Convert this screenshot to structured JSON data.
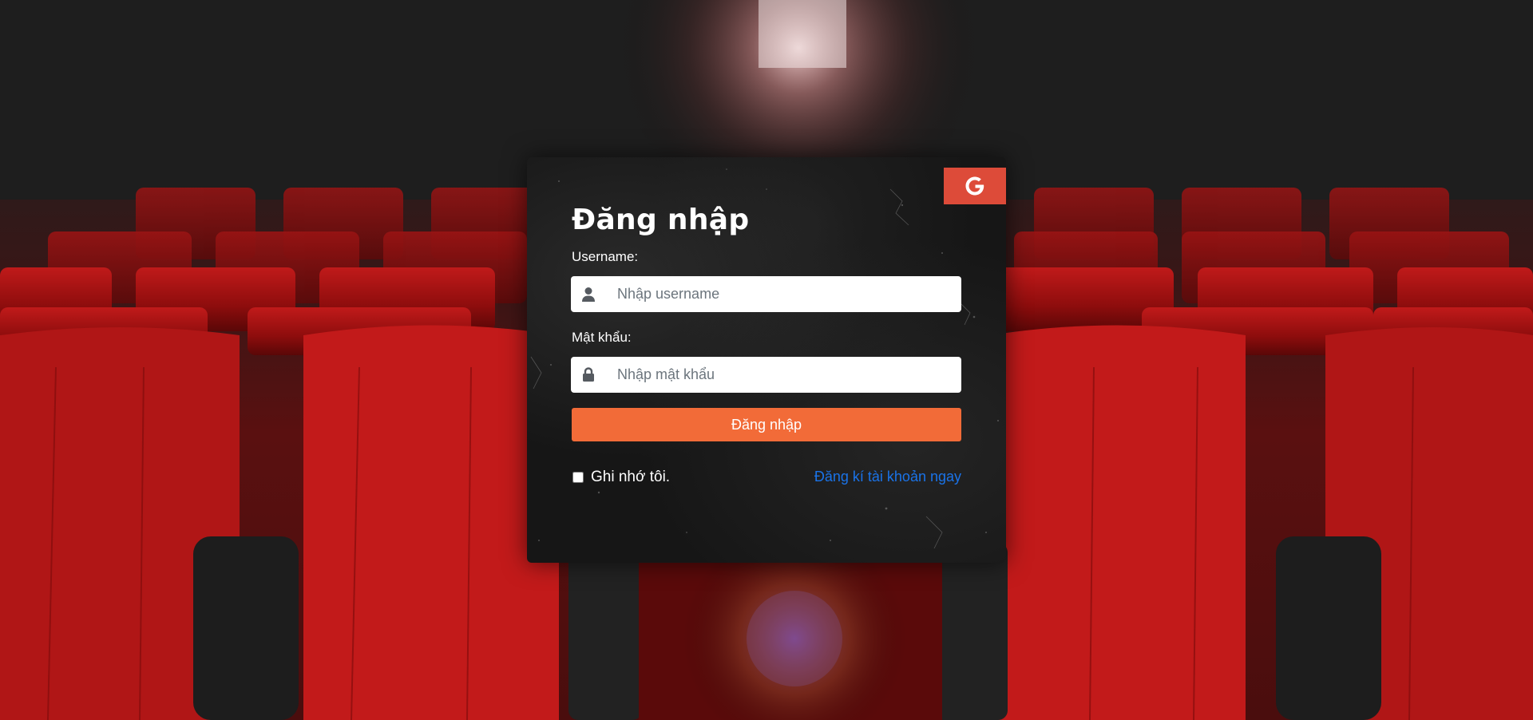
{
  "login": {
    "title": "Đăng nhập",
    "username_label": "Username:",
    "username_placeholder": "Nhập username",
    "password_label": "Mật khẩu:",
    "password_placeholder": "Nhập mật khẩu",
    "submit_label": "Đăng nhập",
    "remember_label": "Ghi nhớ tôi.",
    "register_link": "Đăng kí tài khoản ngay",
    "google_button": {
      "icon": "google-icon",
      "color": "#dd4b39"
    },
    "submit_color": "#f26b38",
    "link_color": "#1a73e8"
  },
  "icons": {
    "username": "user-icon",
    "password": "lock-icon"
  }
}
